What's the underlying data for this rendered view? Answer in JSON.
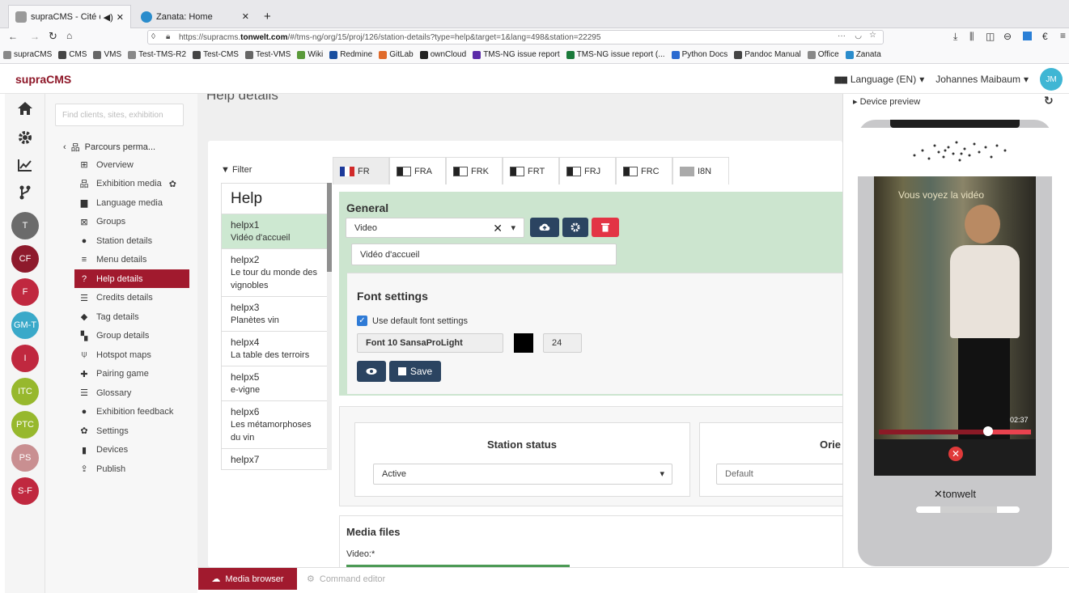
{
  "browser": {
    "tabs": [
      {
        "title": "supraCMS - Cité du vi",
        "active": true
      },
      {
        "title": "Zanata: Home",
        "active": false
      }
    ],
    "new_tab": "+",
    "url_prefix": "https://supracms.",
    "url_domain": "tonwelt.com",
    "url_rest": "/#/tms-ng/org/15/proj/126/station-details?type=help&target=1&lang=498&station=22295",
    "url_actions": "···",
    "bookmarks": [
      "supraCMS",
      "CMS",
      "VMS",
      "Test-TMS-R2",
      "Test-CMS",
      "Test-VMS",
      "Wiki",
      "Redmine",
      "GitLab",
      "ownCloud",
      "TMS-NG issue report",
      "TMS-NG issue report (...",
      "Python Docs",
      "Pandoc Manual",
      "Office",
      "Zanata"
    ]
  },
  "app": {
    "brand": "supraCMS",
    "language": "Language (EN)",
    "user": "Johannes Maibaum",
    "user_initials": "JM",
    "find_placeholder": "Find clients, sites, exhibition"
  },
  "rail": {
    "circles": [
      {
        "label": "T",
        "color": "#6b6b6b"
      },
      {
        "label": "CF",
        "color": "#8e1a2c"
      },
      {
        "label": "F",
        "color": "#c0283f"
      },
      {
        "label": "GM-T",
        "color": "#3aa9c9"
      },
      {
        "label": "I",
        "color": "#c0283f"
      },
      {
        "label": "ITC",
        "color": "#97b82d"
      },
      {
        "label": "PTC",
        "color": "#97b82d"
      },
      {
        "label": "PS",
        "color": "#c98f91"
      },
      {
        "label": "S-F",
        "color": "#c0283f"
      }
    ]
  },
  "nav": {
    "parent": "Parcours perma...",
    "items": [
      {
        "label": "Overview",
        "icon": "table-icon"
      },
      {
        "label": "Exhibition media",
        "icon": "sitemap-icon"
      },
      {
        "label": "Language media",
        "icon": "language-icon"
      },
      {
        "label": "Groups",
        "icon": "object-group-icon"
      },
      {
        "label": "Station details",
        "icon": "info-circle-icon"
      },
      {
        "label": "Menu details",
        "icon": "bars-icon"
      },
      {
        "label": "Help details",
        "icon": "question-icon"
      },
      {
        "label": "Credits details",
        "icon": "align-justify-icon"
      },
      {
        "label": "Tag details",
        "icon": "tag-icon"
      },
      {
        "label": "Group details",
        "icon": "cubes-icon"
      },
      {
        "label": "Hotspot maps",
        "icon": "map-marker-icon"
      },
      {
        "label": "Pairing game",
        "icon": "puzzle-icon"
      },
      {
        "label": "Glossary",
        "icon": "list-icon"
      },
      {
        "label": "Exhibition feedback",
        "icon": "question-circle-icon"
      },
      {
        "label": "Settings",
        "icon": "cog-icon"
      },
      {
        "label": "Devices",
        "icon": "mobile-icon"
      },
      {
        "label": "Publish",
        "icon": "upload-icon"
      }
    ],
    "selected_index": 6
  },
  "main": {
    "page_title": "Help details",
    "filter_label": "Filter",
    "list_header": "Help",
    "list": [
      {
        "key": "helpx1",
        "name": "Vidéo d'accueil"
      },
      {
        "key": "helpx2",
        "name": "Le tour du monde des vignobles"
      },
      {
        "key": "helpx3",
        "name": "Planètes vin"
      },
      {
        "key": "helpx4",
        "name": "La table des terroirs"
      },
      {
        "key": "helpx5",
        "name": "e-vigne"
      },
      {
        "key": "helpx6",
        "name": "Les métamorphoses du vin"
      },
      {
        "key": "helpx7",
        "name": ""
      }
    ],
    "lang_tabs": [
      "FR",
      "FRA",
      "FRK",
      "FRT",
      "FRJ",
      "FRC",
      "I8N"
    ],
    "general": {
      "heading": "General",
      "type_value": "Video",
      "title_value": "Vidéo d'accueil"
    },
    "font": {
      "heading": "Font settings",
      "use_default_label": "Use default font settings",
      "font_name": "Font 10 SansaProLight",
      "color": "#000000",
      "size": "24",
      "save_label": "Save"
    },
    "status": {
      "heading": "Station status",
      "value": "Active",
      "orientation_heading": "Orie",
      "orientation_value": "Default"
    },
    "media": {
      "heading": "Media files",
      "video_label": "Video:*"
    }
  },
  "preview": {
    "title": "Device preview",
    "video_overlay": "Vous voyez la vidéo",
    "time": "02:37",
    "progress": 0.72,
    "brand": "tonwelt"
  },
  "bottom": {
    "media_browser": "Media browser",
    "command_editor": "Command editor"
  }
}
